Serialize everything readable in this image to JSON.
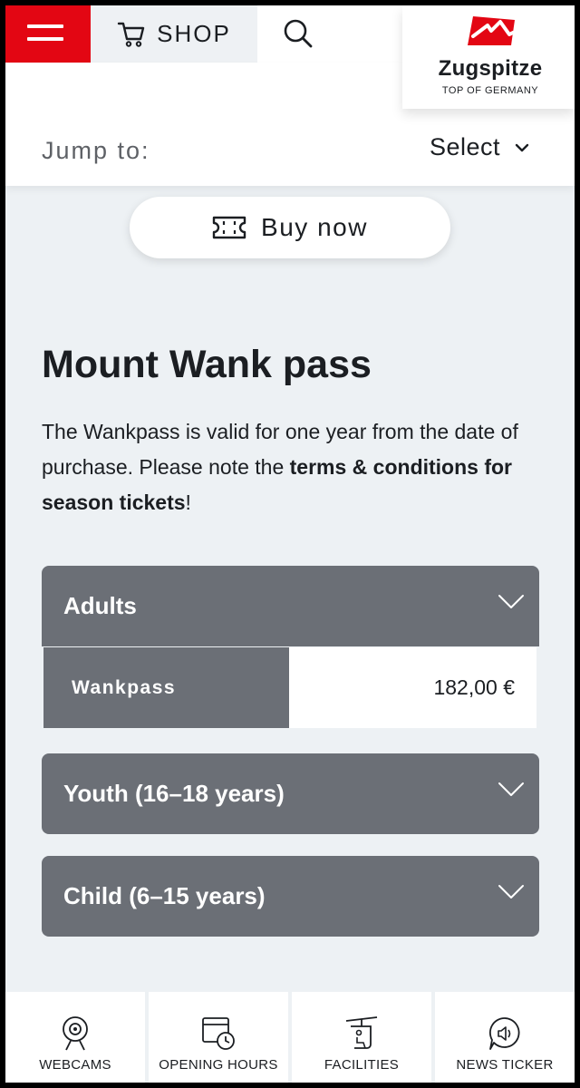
{
  "header": {
    "shop_label": "SHOP",
    "logo_name": "Zugspitze",
    "logo_tagline": "TOP OF GERMANY"
  },
  "jump": {
    "label": "Jump to:",
    "selected": "Select"
  },
  "buy": {
    "label": "Buy now"
  },
  "main": {
    "title": "Mount Wank pass",
    "intro_text": "The Wankpass is valid for one year from the date of purchase. Please note the ",
    "intro_link": "terms & conditions for season tickets",
    "intro_end": "!"
  },
  "accordions": [
    {
      "label": "Adults",
      "rows": [
        {
          "name": "Wankpass",
          "price": "182,00 €"
        }
      ]
    },
    {
      "label": "Youth (16–18 years)"
    },
    {
      "label": "Child (6–15 years)"
    }
  ],
  "bottom_nav": [
    {
      "label": "WEBCAMS",
      "icon": "webcam-icon"
    },
    {
      "label": "OPENING HOURS",
      "icon": "calendar-clock-icon"
    },
    {
      "label": "FACILITIES",
      "icon": "cable-car-icon"
    },
    {
      "label": "NEWS TICKER",
      "icon": "speaker-bubble-icon"
    }
  ],
  "colors": {
    "brand_red": "#e30613",
    "accordion_gray": "#6b6f76",
    "background": "#edf1f4"
  }
}
